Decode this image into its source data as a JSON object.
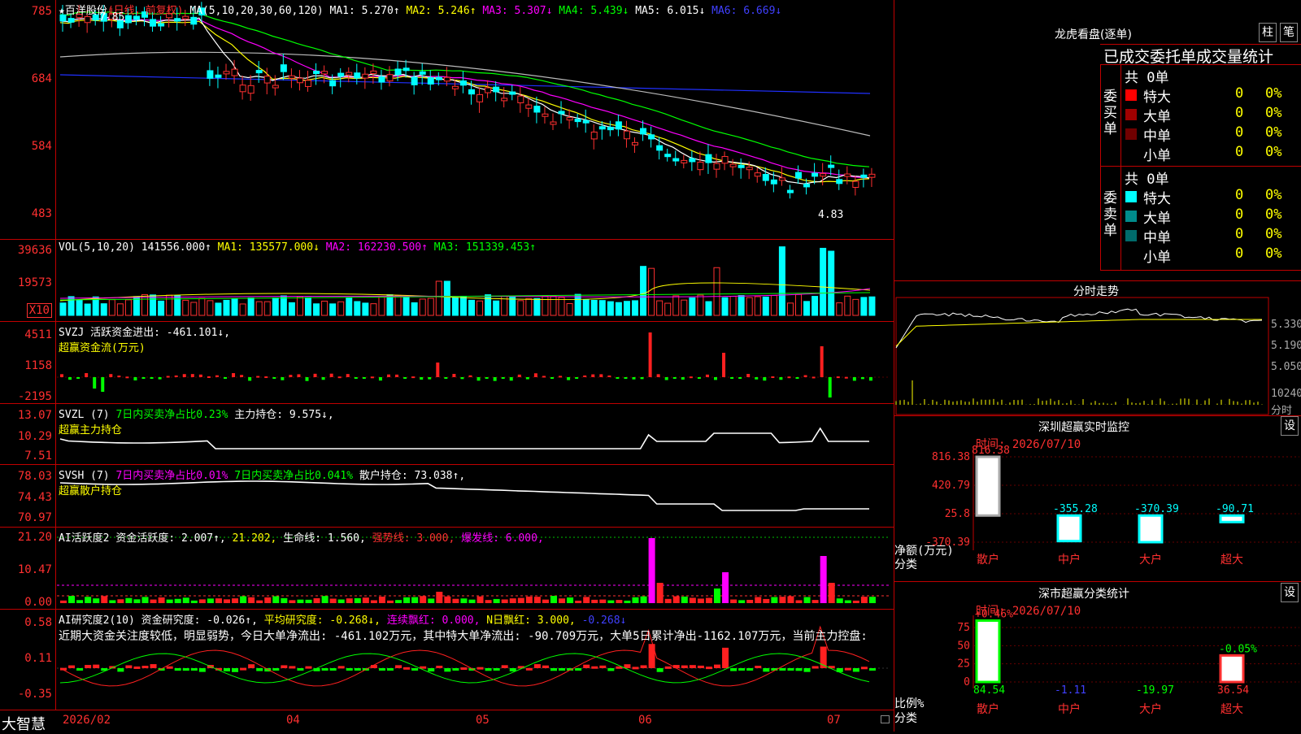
{
  "main": {
    "title": "★百洋股份",
    "period": "(日线，前复权)",
    "ma_label": "MA(5,10,20,30,60,120)",
    "ma1": "MA1: 5.270↑",
    "ma2": "MA2: 5.246↑",
    "ma3": "MA3: 5.307↓",
    "ma4": "MA4: 5.439↓",
    "ma5": "MA5: 6.015↓",
    "ma6": "MA6: 6.669↓",
    "y_labels": [
      "785",
      "684",
      "584",
      "483"
    ],
    "high_label": "7.85",
    "low_label": "4.83"
  },
  "vol": {
    "title": "VOL(5,10,20)",
    "value": "141556.000↑",
    "ma1": "MA1: 135577.000↓",
    "ma2": "MA2: 162230.500↑",
    "ma3": "MA3: 151339.453↑",
    "y_labels": [
      "39636",
      "19573"
    ],
    "unit": "X10"
  },
  "svzj": {
    "title": "SVZJ",
    "line1": "活跃资金进出: -461.101↓,",
    "line2": "超赢资金流(万元)",
    "y_labels": [
      "4511",
      "1158",
      "-2195"
    ]
  },
  "svzl": {
    "title": "SVZL (7)",
    "a": "7日内买卖净占比0.23%",
    "b": "主力持仓: 9.575↓,",
    "line2": "超赢主力持仓",
    "y_labels": [
      "13.07",
      "10.29",
      "7.51"
    ]
  },
  "svsh": {
    "title": "SVSH (7)",
    "a": "7日内买卖净占比0.01%",
    "b": "7日内买卖净占比0.041%",
    "c": "散户持仓: 73.038↑,",
    "line2": "超赢散户持仓",
    "y_labels": [
      "78.03",
      "74.43",
      "70.97"
    ]
  },
  "ai1": {
    "title": "AI活跃度2",
    "a": "资金活跃度: 2.007↑,",
    "b": "21.202,",
    "c": "生命线: 1.560,",
    "d": "强势线: 3.000,",
    "e": "爆发线: 6.000,",
    "y_labels": [
      "21.20",
      "10.47",
      "0.00"
    ]
  },
  "ai2": {
    "title": "AI研究度2(10)",
    "a": "资金研究度: -0.026↑,",
    "b": "平均研究度: -0.268↓,",
    "c": "连续飘红: 0.000,",
    "d": "N日飘红: 3.000,",
    "e": "-0.268↓",
    "desc": "近期大资金关注度较低，明显弱势，今日大单净流出: -461.102万元，其中特大单净流出: -90.709万元，大单5日累计净出-1162.107万元，当前主力控盘:",
    "y_labels": [
      "0.58",
      "0.11",
      "-0.35"
    ]
  },
  "bottom": {
    "logo": "大智慧",
    "months": [
      "2026/02",
      "04",
      "05",
      "06",
      "07"
    ]
  },
  "lhb": {
    "title": "龙虎看盘(逐单)",
    "btn1": "柱",
    "btn2": "笔",
    "tabs": "已成交委托单成交量统计",
    "buy_label": "委买单",
    "sell_label": "委卖单",
    "buy_total": "共 0单",
    "sell_total": "共 0单",
    "rows_buy": [
      {
        "name": "特大",
        "count": "0",
        "pct": "0%",
        "color": "#ff0000"
      },
      {
        "name": "大单",
        "count": "0",
        "pct": "0%",
        "color": "#a00000"
      },
      {
        "name": "中单",
        "count": "0",
        "pct": "0%",
        "color": "#700000"
      },
      {
        "name": "小单",
        "count": "0",
        "pct": "0%",
        "color": "#000000"
      }
    ],
    "rows_sell": [
      {
        "name": "特大",
        "count": "0",
        "pct": "0%",
        "color": "#00ffff"
      },
      {
        "name": "大单",
        "count": "0",
        "pct": "0%",
        "color": "#008b8b"
      },
      {
        "name": "中单",
        "count": "0",
        "pct": "0%",
        "color": "#006b6b"
      },
      {
        "name": "小单",
        "count": "0",
        "pct": "0%",
        "color": "#000000"
      }
    ]
  },
  "fenshi": {
    "title": "分时走势",
    "y_labels": [
      "5.330",
      "5.190",
      "5.050",
      "10240"
    ],
    "x_label": "分时"
  },
  "monitor": {
    "title": "深圳超赢实时监控",
    "btn": "设",
    "time": "时间: 2026/07/10",
    "y_labels": [
      "816.38",
      "420.79",
      "25.8",
      "-370.39"
    ],
    "unit": "净额(万元)",
    "cat_label": "分类",
    "categories": [
      "散户",
      "中户",
      "大户",
      "超大"
    ],
    "values": [
      816.38,
      -355.28,
      -370.39,
      -90.71
    ],
    "value_labels": [
      "816.38",
      "-355.28",
      "-370.39",
      "-90.71"
    ]
  },
  "classify": {
    "title": "深市超赢分类统计",
    "btn": "设",
    "time": "时间: 2026/07/10",
    "y_labels": [
      "75",
      "50",
      "25",
      "0"
    ],
    "unit": "比例%",
    "cat_label": "分类",
    "categories": [
      "散户",
      "中户",
      "大户",
      "超大"
    ],
    "bottom_values": [
      "84.54",
      "-1.11",
      "-19.97",
      "36.54"
    ],
    "top_labels": [
      "+0.46%",
      "",
      "",
      "-0.05%"
    ]
  }
}
